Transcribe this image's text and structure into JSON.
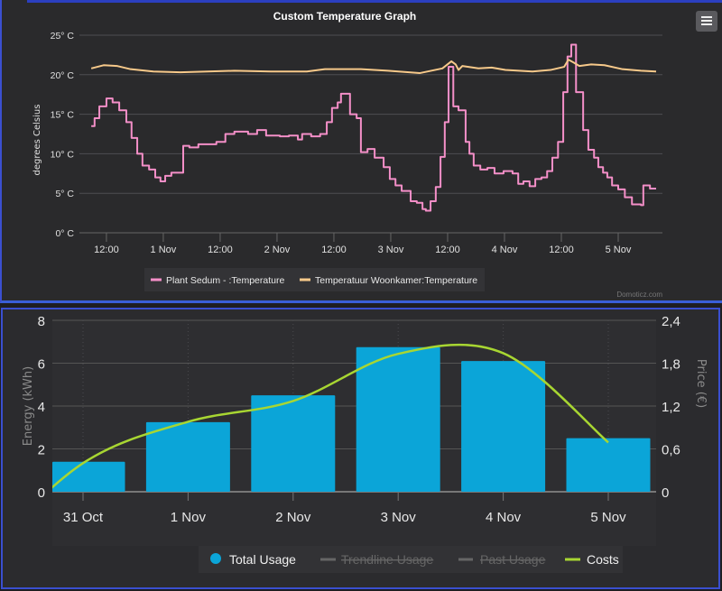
{
  "chart_data": [
    {
      "type": "line",
      "title": "Custom Temperature Graph",
      "ylabel": "degrees Celsius",
      "ylim": [
        0,
        25
      ],
      "yticks": [
        "0° C",
        "5° C",
        "10° C",
        "15° C",
        "20° C",
        "25° C"
      ],
      "ytick_values": [
        0,
        5,
        10,
        15,
        20,
        25
      ],
      "xlim": [
        "10-31 06:18",
        "11-05 09:20"
      ],
      "xticks": [
        {
          "t": "10-31 12:00",
          "label": "12:00"
        },
        {
          "t": "11-01 00:00",
          "label": "1 Nov"
        },
        {
          "t": "11-01 12:00",
          "label": "12:00"
        },
        {
          "t": "11-02 00:00",
          "label": "2 Nov"
        },
        {
          "t": "11-02 12:00",
          "label": "12:00"
        },
        {
          "t": "11-03 00:00",
          "label": "3 Nov"
        },
        {
          "t": "11-03 12:00",
          "label": "12:00"
        },
        {
          "t": "11-04 00:00",
          "label": "4 Nov"
        },
        {
          "t": "11-04 12:00",
          "label": "12:00"
        },
        {
          "t": "11-05 00:00",
          "label": "5 Nov"
        }
      ],
      "grid": true,
      "legend_position": "bottom",
      "credit": "Domoticz.com",
      "series": [
        {
          "name": "Plant Sedum - :Temperature",
          "color": "#f48fc8",
          "step": true,
          "points": [
            [
              "10-31 08:48",
              13.5
            ],
            [
              "10-31 09:30",
              14.5
            ],
            [
              "10-31 10:30",
              16
            ],
            [
              "10-31 12:00",
              17
            ],
            [
              "10-31 13:18",
              16.5
            ],
            [
              "10-31 14:42",
              15.5
            ],
            [
              "10-31 16:12",
              14
            ],
            [
              "10-31 17:18",
              12
            ],
            [
              "10-31 18:30",
              10
            ],
            [
              "10-31 19:36",
              8.5
            ],
            [
              "10-31 21:00",
              8
            ],
            [
              "10-31 22:18",
              7
            ],
            [
              "10-31 23:24",
              6.5
            ],
            [
              "11-01 00:24",
              7.2
            ],
            [
              "11-01 01:42",
              7.6
            ],
            [
              "11-01 04:12",
              11
            ],
            [
              "11-01 05:30",
              10.8
            ],
            [
              "11-01 07:24",
              11.2
            ],
            [
              "11-01 11:12",
              11.5
            ],
            [
              "11-01 13:06",
              12.5
            ],
            [
              "11-01 15:00",
              12.8
            ],
            [
              "11-01 17:54",
              12.5
            ],
            [
              "11-01 19:48",
              13
            ],
            [
              "11-01 21:42",
              12.3
            ],
            [
              "11-02 00:36",
              12.2
            ],
            [
              "11-02 02:30",
              12.3
            ],
            [
              "11-02 04:24",
              11.8
            ],
            [
              "11-02 05:18",
              12.5
            ],
            [
              "11-02 07:12",
              12.2
            ],
            [
              "11-02 09:06",
              12.5
            ],
            [
              "11-02 10:30",
              14
            ],
            [
              "11-02 11:36",
              15.8
            ],
            [
              "11-02 12:48",
              16.5
            ],
            [
              "11-02 13:30",
              17.6
            ],
            [
              "11-02 14:54",
              17.6
            ],
            [
              "11-02 15:24",
              15
            ],
            [
              "11-02 16:48",
              14.5
            ],
            [
              "11-02 17:42",
              10.2
            ],
            [
              "11-02 19:06",
              10.6
            ],
            [
              "11-02 20:36",
              9.5
            ],
            [
              "11-02 22:30",
              8.3
            ],
            [
              "11-02 23:48",
              6.8
            ],
            [
              "11-03 01:00",
              6
            ],
            [
              "11-03 02:18",
              5.3
            ],
            [
              "11-03 04:12",
              4
            ],
            [
              "11-03 05:30",
              3.8
            ],
            [
              "11-03 06:42",
              3
            ],
            [
              "11-03 07:24",
              2.8
            ],
            [
              "11-03 08:24",
              4
            ],
            [
              "11-03 09:30",
              5.8
            ],
            [
              "11-03 10:30",
              9.6
            ],
            [
              "11-03 11:24",
              14
            ],
            [
              "11-03 12:12",
              21
            ],
            [
              "11-03 13:12",
              16
            ],
            [
              "11-03 14:18",
              15.5
            ],
            [
              "11-03 15:48",
              11.5
            ],
            [
              "11-03 16:36",
              10
            ],
            [
              "11-03 17:30",
              8.5
            ],
            [
              "11-03 18:54",
              8
            ],
            [
              "11-03 20:24",
              8.2
            ],
            [
              "11-03 21:54",
              7.5
            ],
            [
              "11-03 23:48",
              7.8
            ],
            [
              "11-04 01:42",
              7.5
            ],
            [
              "11-04 02:54",
              6.2
            ],
            [
              "11-04 04:00",
              6.5
            ],
            [
              "11-04 05:18",
              5.9
            ],
            [
              "11-04 06:30",
              6.8
            ],
            [
              "11-04 07:48",
              7
            ],
            [
              "11-04 09:00",
              7.8
            ],
            [
              "11-04 10:06",
              9.5
            ],
            [
              "11-04 11:18",
              11.5
            ],
            [
              "11-04 12:24",
              17.8
            ],
            [
              "11-04 13:18",
              22.3
            ],
            [
              "11-04 14:06",
              23.8
            ],
            [
              "11-04 15:06",
              17.8
            ],
            [
              "11-04 16:36",
              13
            ],
            [
              "11-04 17:42",
              10.5
            ],
            [
              "11-04 18:54",
              9.5
            ],
            [
              "11-04 19:48",
              8.3
            ],
            [
              "11-04 20:48",
              7.6
            ],
            [
              "11-04 21:42",
              7
            ],
            [
              "11-04 22:42",
              6
            ],
            [
              "11-05 00:00",
              5.5
            ],
            [
              "11-05 01:24",
              4.5
            ],
            [
              "11-05 02:54",
              3.6
            ],
            [
              "11-05 04:48",
              3.5
            ],
            [
              "11-05 05:18",
              6
            ],
            [
              "11-05 06:42",
              5.6
            ],
            [
              "11-05 08:00",
              5.6
            ]
          ]
        },
        {
          "name": "Temperatuur Woonkamer:Temperature",
          "color": "#f7c98a",
          "step": false,
          "points": [
            [
              "10-31 08:48",
              20.8
            ],
            [
              "10-31 11:24",
              21.2
            ],
            [
              "10-31 14:18",
              21.1
            ],
            [
              "10-31 17:06",
              20.7
            ],
            [
              "10-31 21:54",
              20.4
            ],
            [
              "11-01 03:36",
              20.3
            ],
            [
              "11-01 09:18",
              20.4
            ],
            [
              "11-01 15:00",
              20.5
            ],
            [
              "11-01 22:42",
              20.4
            ],
            [
              "11-02 06:18",
              20.4
            ],
            [
              "11-02 10:06",
              20.7
            ],
            [
              "11-02 17:42",
              20.7
            ],
            [
              "11-02 23:24",
              20.5
            ],
            [
              "11-03 06:06",
              20.2
            ],
            [
              "11-03 10:54",
              20.8
            ],
            [
              "11-03 12:48",
              21.7
            ],
            [
              "11-03 13:42",
              21.3
            ],
            [
              "11-03 14:18",
              20.6
            ],
            [
              "11-03 15:06",
              21.1
            ],
            [
              "11-03 18:30",
              20.8
            ],
            [
              "11-03 21:18",
              20.9
            ],
            [
              "11-04 00:12",
              20.6
            ],
            [
              "11-04 05:54",
              20.4
            ],
            [
              "11-04 09:42",
              20.6
            ],
            [
              "11-04 12:36",
              21.0
            ],
            [
              "11-04 13:30",
              21.9
            ],
            [
              "11-04 14:42",
              21.5
            ],
            [
              "11-04 15:48",
              21.1
            ],
            [
              "11-04 18:18",
              21.3
            ],
            [
              "11-04 21:06",
              21.2
            ],
            [
              "11-05 00:54",
              20.7
            ],
            [
              "11-05 04:48",
              20.5
            ],
            [
              "11-05 08:00",
              20.4
            ]
          ]
        }
      ]
    },
    {
      "type": "bar",
      "categories": [
        "31 Oct",
        "1 Nov",
        "2 Nov",
        "3 Nov",
        "4 Nov",
        "5 Nov"
      ],
      "ylabel": "Energy (kWh)",
      "ylim": [
        0,
        8
      ],
      "yticks": [
        "0",
        "2",
        "4",
        "6",
        "8"
      ],
      "ytick_values": [
        0,
        2,
        4,
        6,
        8
      ],
      "y2label": "Price (€)",
      "y2lim": [
        0,
        2.4
      ],
      "y2ticks": [
        "0",
        "0,6",
        "1,2",
        "1,8",
        "2,4"
      ],
      "y2tick_values": [
        0,
        0.6,
        1.2,
        1.8,
        2.4
      ],
      "grid": true,
      "legend_position": "bottom",
      "series": [
        {
          "name": "Total Usage",
          "type": "bar",
          "color": "#0ba5d8",
          "axis": "left",
          "values": [
            1.4,
            3.25,
            4.5,
            6.75,
            6.1,
            2.5
          ]
        },
        {
          "name": "Trendline Usage",
          "type": "line",
          "color": "#666666",
          "hidden": true,
          "values": []
        },
        {
          "name": "Past Usage",
          "type": "line",
          "color": "#666666",
          "hidden": true,
          "values": []
        },
        {
          "name": "Costs",
          "type": "spline",
          "color": "#a8d632",
          "axis": "right",
          "values": [
            0.4,
            0.98,
            1.27,
            1.93,
            1.94,
            0.69
          ]
        }
      ]
    }
  ]
}
